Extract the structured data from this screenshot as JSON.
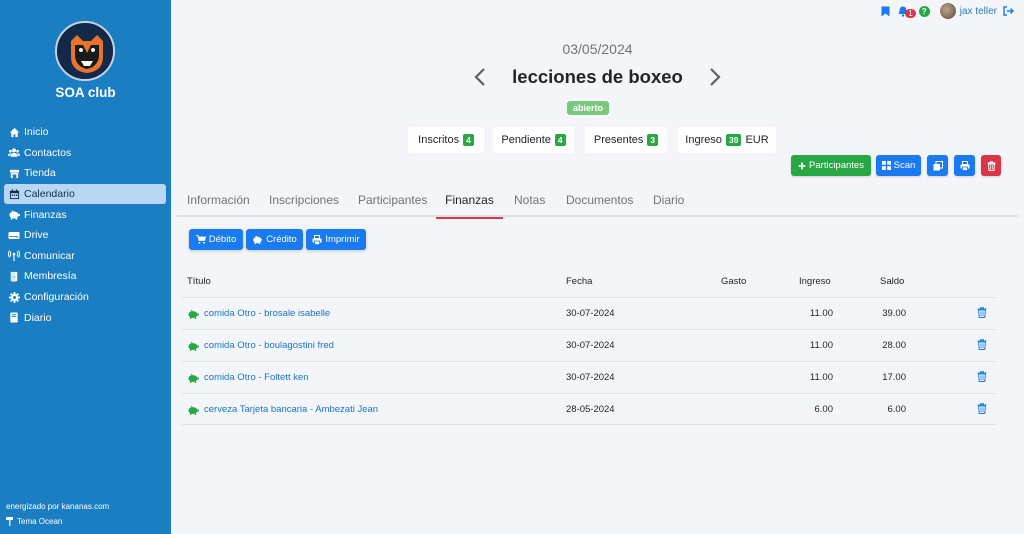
{
  "sidebar": {
    "club_name": "SOA club",
    "items": [
      {
        "label": "Inicio",
        "icon": "home-icon"
      },
      {
        "label": "Contactos",
        "icon": "users-icon"
      },
      {
        "label": "Tienda",
        "icon": "store-icon"
      },
      {
        "label": "Calendario",
        "icon": "calendar-icon",
        "active": true
      },
      {
        "label": "Finanzas",
        "icon": "piggy-bank-icon"
      },
      {
        "label": "Drive",
        "icon": "hdd-icon"
      },
      {
        "label": "Comunicar",
        "icon": "broadcast-icon"
      },
      {
        "label": "Membresía",
        "icon": "door-icon"
      },
      {
        "label": "Configuración",
        "icon": "gear-icon"
      },
      {
        "label": "Diario",
        "icon": "book-icon"
      }
    ],
    "powered_by": "energizado por kananas.com",
    "theme": "Tema Ocean"
  },
  "topbar": {
    "notification_count": "1",
    "help": "?",
    "user_name": "jax teller"
  },
  "event": {
    "date": "03/05/2024",
    "title": "lecciones de boxeo",
    "status": "abierto"
  },
  "stats": {
    "inscritos_label": "Inscritos",
    "inscritos": "4",
    "pendiente_label": "Pendiente",
    "pendiente": "4",
    "presentes_label": "Presentes",
    "presentes": "3",
    "ingreso_label": "Ingreso",
    "ingreso": "39",
    "currency": "EUR"
  },
  "actions": {
    "participantes": "Participantes",
    "scan": "Scan"
  },
  "tabs": [
    {
      "label": "Información"
    },
    {
      "label": "Inscripciones"
    },
    {
      "label": "Participantes"
    },
    {
      "label": "Finanzas",
      "active": true
    },
    {
      "label": "Notas"
    },
    {
      "label": "Documentos"
    },
    {
      "label": "Diario"
    }
  ],
  "finance_buttons": {
    "debito": "Débito",
    "credito": "Crédito",
    "imprimir": "Imprimir"
  },
  "table": {
    "headers": {
      "titulo": "Título",
      "fecha": "Fecha",
      "gasto": "Gasto",
      "ingreso": "Ingreso",
      "saldo": "Saldo"
    },
    "rows": [
      {
        "title": "comida Otro - brosale isabelle",
        "date": "30-07-2024",
        "gasto": "",
        "ingreso": "11.00",
        "saldo": "39.00"
      },
      {
        "title": "comida Otro - boulagostini fred",
        "date": "30-07-2024",
        "gasto": "",
        "ingreso": "11.00",
        "saldo": "28.00"
      },
      {
        "title": "comida Otro - Foltett ken",
        "date": "30-07-2024",
        "gasto": "",
        "ingreso": "11.00",
        "saldo": "17.00"
      },
      {
        "title": "cerveza Tarjeta bancaria - Ambezati Jean",
        "date": "28-05-2024",
        "gasto": "",
        "ingreso": "6.00",
        "saldo": "6.00"
      }
    ]
  },
  "colors": {
    "sidebar": "#1b7ec2",
    "primary": "#1a7bf0",
    "success": "#28a745",
    "danger": "#dc3545",
    "link": "#1a73c8"
  }
}
